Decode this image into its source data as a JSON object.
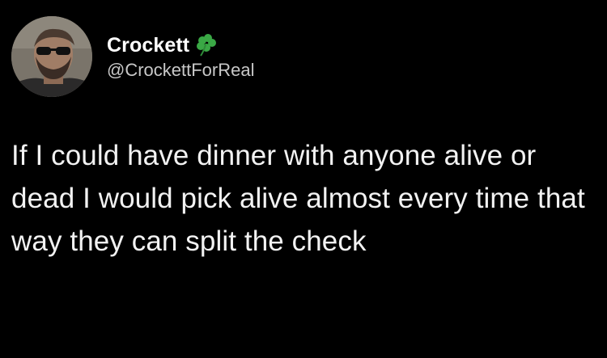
{
  "author": {
    "display_name": "Crockett",
    "handle": "@CrockettForReal",
    "badge_icon": "four-leaf-clover-icon",
    "badge_color": "#3aa845"
  },
  "tweet": {
    "text": "If I could have dinner with anyone alive or dead I would pick alive almost every time that way they can split the check"
  },
  "colors": {
    "background": "#000000",
    "text": "#f2f2f2",
    "handle": "#c8c8c8"
  }
}
